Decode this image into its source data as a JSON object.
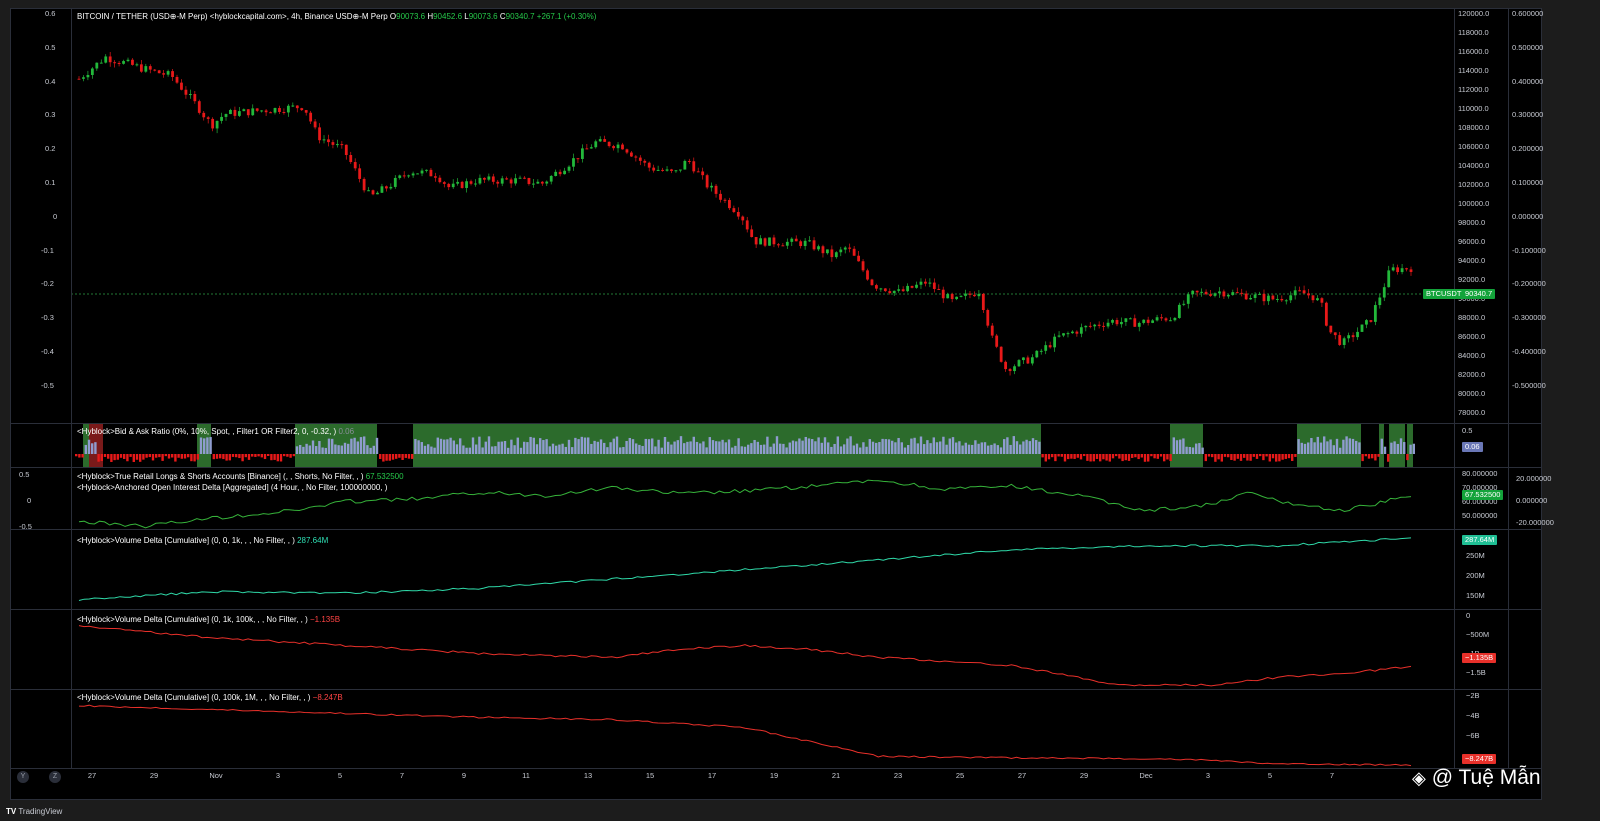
{
  "header": {
    "symbol": "BITCOIN / TETHER (USD⊕-M Perp) <hyblockcapital.com>, 4h, Binance USD⊕-M Perp",
    "open_label": "O",
    "open": "90073.6",
    "high_label": "H",
    "high": "90452.6",
    "low_label": "L",
    "low": "90073.6",
    "close_label": "C",
    "close": "90340.7",
    "change": "+267.1 (+0.30%)"
  },
  "price_axis": [
    "120000.0",
    "118000.0",
    "116000.0",
    "114000.0",
    "112000.0",
    "110000.0",
    "108000.0",
    "106000.0",
    "104000.0",
    "102000.0",
    "100000.0",
    "98000.0",
    "96000.0",
    "94000.0",
    "92000.0",
    "90000.0",
    "88000.0",
    "86000.0",
    "84000.0",
    "82000.0",
    "80000.0",
    "78000.0"
  ],
  "ratio_axis": [
    "0.600000",
    "0.500000",
    "0.400000",
    "0.300000",
    "0.200000",
    "0.100000",
    "0.000000",
    "-0.100000",
    "-0.200000",
    "-0.300000",
    "-0.400000",
    "-0.500000"
  ],
  "left_axis": [
    "0.6",
    "0.5",
    "0.4",
    "0.3",
    "0.2",
    "0.1",
    "0",
    "-0.1",
    "-0.2",
    "-0.3",
    "-0.4",
    "-0.5"
  ],
  "price_tag": {
    "symbol": "BTCUSDT",
    "value": "90340.7"
  },
  "panes": {
    "bid_ask": {
      "legend": "<Hyblock>Bid & Ask Ratio (0%, 10%, Spot, , Filter1 OR Filter2, 0, -0.32, )",
      "value": "0.06",
      "axis": [
        "0.5"
      ],
      "tag": "0.06"
    },
    "retail": {
      "legend1": "<Hyblock>True Retail Longs & Shorts Accounts [Binance] (, , Shorts, No Filter, , )",
      "value1": "67.532500",
      "legend2": "<Hyblock>Anchored Open Interest Delta [Aggregated] (4 Hour, , No Filter, 100000000, )",
      "left_axis": [
        "0.5",
        "0",
        "-0.5"
      ],
      "axis": [
        "80.000000",
        "70.000000",
        "60.000000",
        "50.000000"
      ],
      "axis_right": [
        "20.000000",
        "0.000000",
        "-20.000000"
      ],
      "tag": "67.532500"
    },
    "vd1": {
      "legend": "<Hyblock>Volume Delta [Cumulative] (0, 0, 1k, , , No Filter, , )",
      "value": "287.64M",
      "axis": [
        "250M",
        "200M",
        "150M"
      ],
      "tag": "287.64M"
    },
    "vd2": {
      "legend": "<Hyblock>Volume Delta [Cumulative] (0, 1k, 100k, , , No Filter, , )",
      "value": "−1.135B",
      "axis": [
        "0",
        "−500M",
        "−1B",
        "−1.5B"
      ],
      "tag": "−1.135B"
    },
    "vd3": {
      "legend": "<Hyblock>Volume Delta [Cumulative] (0, 100k, 1M, , , No Filter, , )",
      "value": "−8.247B",
      "axis": [
        "−2B",
        "−4B",
        "−6B"
      ],
      "tag": "−8.247B"
    }
  },
  "time_axis": [
    "27",
    "29",
    "Nov",
    "3",
    "5",
    "7",
    "9",
    "11",
    "13",
    "15",
    "17",
    "19",
    "21",
    "23",
    "25",
    "27",
    "29",
    "Dec",
    "3",
    "5",
    "7"
  ],
  "controls": {
    "y": "Y",
    "z": "Z"
  },
  "brand": "TradingView",
  "watermark": "@ Tuệ Mẫn",
  "colors": {
    "up": "#22b83a",
    "down": "#e81919",
    "green_zone": "#2c6b2c",
    "bar": "#8f9ccf",
    "teal": "#2fd9a8",
    "red_line": "#e8302a"
  }
}
